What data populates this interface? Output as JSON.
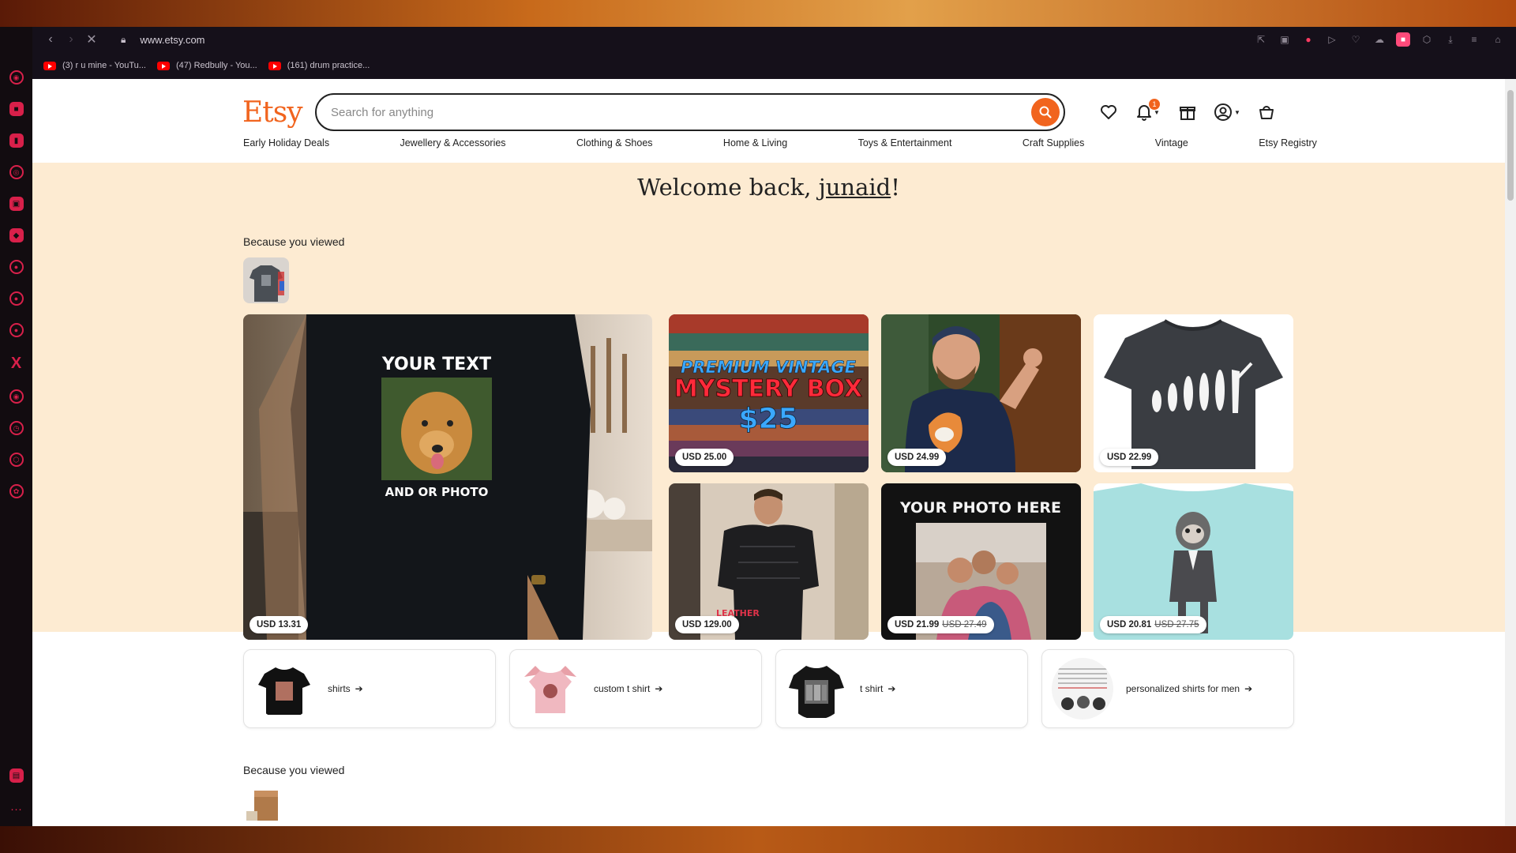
{
  "browser": {
    "url": "www.etsy.com",
    "bookmarks": [
      {
        "label": "(3) r u mine - YouTu..."
      },
      {
        "label": "(47) Redbully - You..."
      },
      {
        "label": "(161) drum practice..."
      }
    ]
  },
  "etsy": {
    "logo": "Etsy",
    "search_placeholder": "Search for anything",
    "notification_count": "1",
    "categories": [
      "Early Holiday Deals",
      "Jewellery & Accessories",
      "Clothing & Shoes",
      "Home & Living",
      "Toys & Entertainment",
      "Craft Supplies",
      "Vintage",
      "Etsy Registry"
    ],
    "welcome_prefix": "Welcome back, ",
    "welcome_user": "junaid",
    "welcome_suffix": "!",
    "section_label_1": "Because you viewed",
    "section_label_2": "Because you viewed",
    "products": [
      {
        "price": "USD 13.31",
        "image_text_top": "YOUR TEXT",
        "image_text_bottom": "AND OR PHOTO"
      },
      {
        "price": "USD 25.00",
        "image_text_1": "PREMIUM VINTAGE",
        "image_text_2": "MYSTERY BOX",
        "image_text_3": "$25"
      },
      {
        "price": "USD 24.99"
      },
      {
        "price": "USD 22.99"
      },
      {
        "price": "USD 129.00",
        "image_text": "LEATHER"
      },
      {
        "price": "USD 21.99",
        "original_price": "USD 27.49",
        "image_text": "YOUR PHOTO HERE"
      },
      {
        "price": "USD 20.81",
        "original_price": "USD 27.75"
      }
    ],
    "related_searches": [
      {
        "label": "shirts"
      },
      {
        "label": "custom t shirt"
      },
      {
        "label": "t shirt"
      },
      {
        "label": "personalized shirts for men"
      }
    ]
  },
  "colors": {
    "brand_orange": "#f1641e",
    "peach_band": "#fdebd2",
    "browser_accent": "#d8204a"
  }
}
